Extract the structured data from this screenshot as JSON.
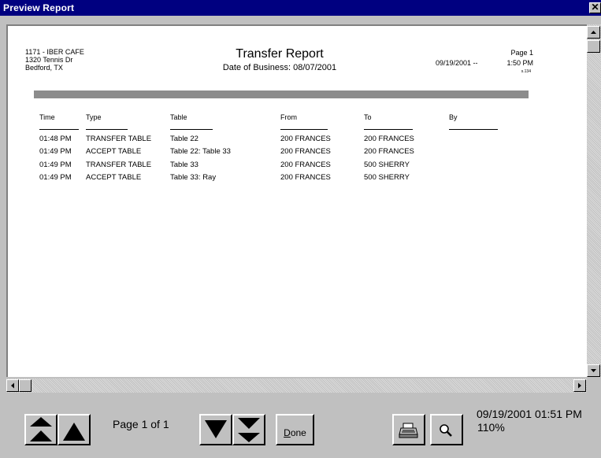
{
  "window": {
    "title": "Preview Report",
    "close_glyph": "✕"
  },
  "report": {
    "store_line1": "1171 - IBER CAFE",
    "store_line2": "1320 Tennis Dr",
    "store_line3": "Bedford, TX",
    "title": "Transfer Report",
    "subtitle": "Date of Business: 08/07/2001",
    "page_label": "Page 1",
    "print_date": "09/19/2001 --",
    "print_time": "1:50 PM",
    "tiny_code": "s.134",
    "columns": [
      "Time",
      "Type",
      "Table",
      "From",
      "To",
      "By"
    ],
    "rows": [
      [
        "01:48 PM",
        "TRANSFER TABLE",
        "Table 22",
        "200 FRANCES",
        "200 FRANCES",
        ""
      ],
      [
        "01:49 PM",
        "ACCEPT TABLE",
        "Table 22: Table 33",
        "200 FRANCES",
        "200 FRANCES",
        ""
      ],
      [
        "01:49 PM",
        "TRANSFER TABLE",
        "Table 33",
        "200 FRANCES",
        "500 SHERRY",
        ""
      ],
      [
        "01:49 PM",
        "ACCEPT TABLE",
        "Table 33: Ray",
        "200 FRANCES",
        "500 SHERRY",
        ""
      ]
    ]
  },
  "toolbar": {
    "first_page_icon": "first-page-icon",
    "prev_page_icon": "prev-page-icon",
    "page_status": "Page 1 of 1",
    "next_page_icon": "next-page-icon",
    "last_page_icon": "last-page-icon",
    "done_mnemonic": "D",
    "done_rest": "one",
    "print_icon": "printer-icon",
    "zoom_icon": "magnifier-icon"
  },
  "status": {
    "datetime": "09/19/2001 01:51 PM",
    "zoom": "110%"
  },
  "colors": {
    "titlebar": "#000080",
    "chrome": "#c0c0c0",
    "rule_bar": "#8c8c8c"
  }
}
